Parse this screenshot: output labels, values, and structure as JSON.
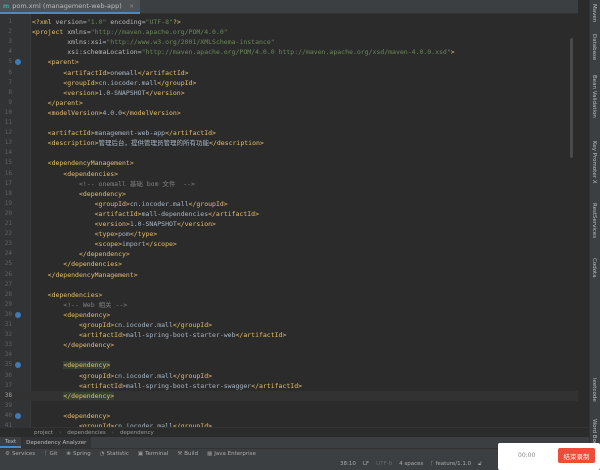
{
  "tab": {
    "title": "pom.xml (management-web-app)",
    "icon": "maven-file-icon"
  },
  "code_lines": [
    [
      [
        "p",
        "<?xml "
      ],
      [
        "a",
        "version"
      ],
      [
        "x",
        "="
      ],
      [
        "v",
        "\"1.0\""
      ],
      [
        "a",
        " encoding"
      ],
      [
        "x",
        "="
      ],
      [
        "v",
        "\"UTF-8\""
      ],
      [
        "p",
        "?>"
      ]
    ],
    [
      [
        "t",
        "<project "
      ],
      [
        "a",
        "xmlns"
      ],
      [
        "x",
        "="
      ],
      [
        "v",
        "\"http://maven.apache.org/POM/4.0.0\""
      ]
    ],
    [
      [
        "a",
        "         xmlns:xsi"
      ],
      [
        "x",
        "="
      ],
      [
        "v",
        "\"http://www.w3.org/2001/XMLSchema-instance\""
      ]
    ],
    [
      [
        "a",
        "         xsi:schemaLocation"
      ],
      [
        "x",
        "="
      ],
      [
        "v",
        "\"http://maven.apache.org/POM/4.0.0 http://maven.apache.org/xsd/maven-4.0.0.xsd\""
      ],
      [
        "t",
        ">"
      ]
    ],
    [
      [
        "t",
        "    <parent>"
      ]
    ],
    [
      [
        "t",
        "        <artifactId>"
      ],
      [
        "x",
        "onemall"
      ],
      [
        "t",
        "</artifactId>"
      ]
    ],
    [
      [
        "t",
        "        <groupId>"
      ],
      [
        "x",
        "cn.iocoder.mall"
      ],
      [
        "t",
        "</groupId>"
      ]
    ],
    [
      [
        "t",
        "        <version>"
      ],
      [
        "x",
        "1.0-SNAPSHOT"
      ],
      [
        "t",
        "</version>"
      ]
    ],
    [
      [
        "t",
        "    </parent>"
      ]
    ],
    [
      [
        "t",
        "    <modelVersion>"
      ],
      [
        "x",
        "4.0.0"
      ],
      [
        "t",
        "</modelVersion>"
      ]
    ],
    [],
    [
      [
        "t",
        "    <artifactId>"
      ],
      [
        "x",
        "management-web-app"
      ],
      [
        "t",
        "</artifactId>"
      ]
    ],
    [
      [
        "t",
        "    <description>"
      ],
      [
        "x",
        "管理后台，提供管理员管理的所有功能"
      ],
      [
        "t",
        "</description>"
      ]
    ],
    [],
    [
      [
        "t",
        "    <dependencyManagement>"
      ]
    ],
    [
      [
        "t",
        "        <dependencies>"
      ]
    ],
    [
      [
        "c",
        "            <!-- onemall 基础 bom 文件  -->"
      ]
    ],
    [
      [
        "t",
        "            <dependency>"
      ]
    ],
    [
      [
        "t",
        "                <groupId>"
      ],
      [
        "x",
        "cn.iocoder.mall"
      ],
      [
        "t",
        "</groupId>"
      ]
    ],
    [
      [
        "t",
        "                <artifactId>"
      ],
      [
        "x",
        "mall-dependencies"
      ],
      [
        "t",
        "</artifactId>"
      ]
    ],
    [
      [
        "t",
        "                <version>"
      ],
      [
        "x",
        "1.0-SNAPSHOT"
      ],
      [
        "t",
        "</version>"
      ]
    ],
    [
      [
        "t",
        "                <type>"
      ],
      [
        "x",
        "pom"
      ],
      [
        "t",
        "</type>"
      ]
    ],
    [
      [
        "t",
        "                <scope>"
      ],
      [
        "x",
        "import"
      ],
      [
        "t",
        "</scope>"
      ]
    ],
    [
      [
        "t",
        "            </dependency>"
      ]
    ],
    [
      [
        "t",
        "        </dependencies>"
      ]
    ],
    [
      [
        "t",
        "    </dependencyManagement>"
      ]
    ],
    [],
    [
      [
        "t",
        "    <dependencies>"
      ]
    ],
    [
      [
        "c",
        "        <!-- Web 相关 -->"
      ]
    ],
    [
      [
        "t",
        "        <dependency>"
      ]
    ],
    [
      [
        "t",
        "            <groupId>"
      ],
      [
        "x",
        "cn.iocoder.mall"
      ],
      [
        "t",
        "</groupId>"
      ]
    ],
    [
      [
        "t",
        "            <artifactId>"
      ],
      [
        "x",
        "mall-spring-boot-starter-web"
      ],
      [
        "t",
        "</artifactId>"
      ]
    ],
    [
      [
        "t",
        "        </dependency>"
      ]
    ],
    [],
    [
      [
        "x",
        "        "
      ],
      [
        "t hl",
        "<dependency>"
      ]
    ],
    [
      [
        "t",
        "            <groupId>"
      ],
      [
        "x",
        "cn.iocoder.mall"
      ],
      [
        "t",
        "</groupId>"
      ]
    ],
    [
      [
        "t",
        "            <artifactId>"
      ],
      [
        "x",
        "mall-spring-boot-starter-swagger"
      ],
      [
        "t",
        "</artifactId>"
      ]
    ],
    [
      [
        "x",
        "        "
      ],
      [
        "t hl",
        "</dependency>"
      ]
    ],
    [],
    [
      [
        "t",
        "        <dependency>"
      ]
    ],
    [
      [
        "t",
        "            <groupId>"
      ],
      [
        "x",
        "cn.iocoder.mall"
      ],
      [
        "t",
        "</groupId>"
      ]
    ]
  ],
  "current_line": 38,
  "gutter_marks": [
    5,
    30,
    35,
    40
  ],
  "right_tools": [
    "Maven",
    "Database",
    "Bean Validation",
    "Key Promoter X",
    "RestServices",
    "Codota",
    "leetcode",
    "Word Book"
  ],
  "breadcrumb": [
    "project",
    "dependencies",
    "dependency"
  ],
  "bottom_tabs": [
    "Text",
    "Dependency Analyzer"
  ],
  "toolbar": [
    {
      "label": "Services",
      "icon": "services-icon"
    },
    {
      "label": "Git",
      "icon": "git-branch-icon"
    },
    {
      "label": "Spring",
      "icon": "spring-icon"
    },
    {
      "label": "Statistic",
      "icon": "statistic-icon"
    },
    {
      "label": "Terminal",
      "icon": "terminal-icon"
    },
    {
      "label": "Build",
      "icon": "build-icon"
    },
    {
      "label": "Java Enterprise",
      "icon": "java-enterprise-icon"
    }
  ],
  "status": {
    "position": "38:10",
    "line_sep": "LF",
    "encoding": "UTF-8",
    "indent": "4 spaces",
    "branch": "feature/1.1.0"
  },
  "recorder": {
    "time": "00:00",
    "stop_label": "结束录制"
  }
}
